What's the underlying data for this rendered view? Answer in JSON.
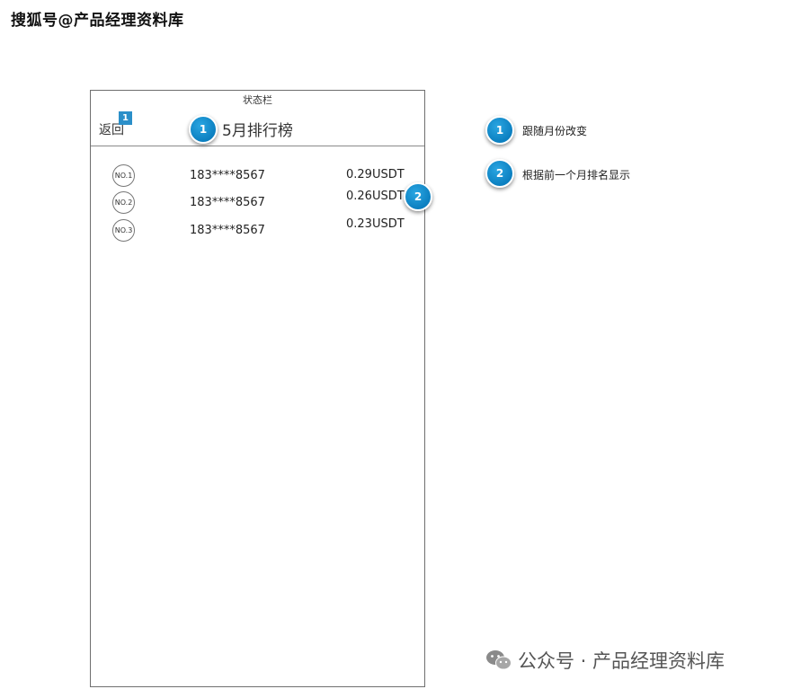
{
  "watermark_top": "搜狐号@产品经理资料库",
  "phone": {
    "status_bar": "状态栏",
    "back_label": "返回",
    "tag_marker": "1",
    "title": "5月排行榜",
    "rows": [
      {
        "rank": "NO.1",
        "phone": "183****8567",
        "amount": "0.29USDT"
      },
      {
        "rank": "NO.2",
        "phone": "183****8567",
        "amount": "0.26USDT"
      },
      {
        "rank": "NO.3",
        "phone": "183****8567",
        "amount": "0.23USDT"
      }
    ]
  },
  "bubbles": {
    "title_marker": "1",
    "amount_marker": "2"
  },
  "notes": [
    {
      "number": "1",
      "text": "跟随月份改变"
    },
    {
      "number": "2",
      "text": "根据前一个月排名显示"
    }
  ],
  "watermark_bottom": {
    "icon": "wechat-icon",
    "text": "公众号 · 产品经理资料库"
  },
  "colors": {
    "bubble": "#0b7fc0",
    "tag": "#2b8fc9"
  }
}
